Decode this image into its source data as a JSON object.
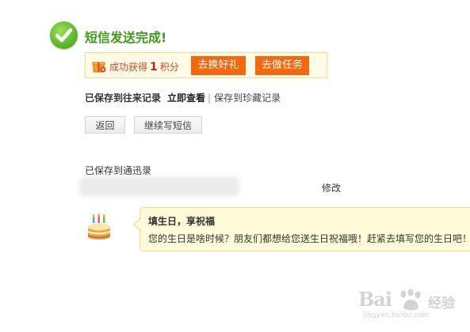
{
  "status": {
    "title": "短信发送完成!"
  },
  "points": {
    "prefix": "成功获得",
    "amount": "1",
    "suffix": "积分",
    "gift_button": "去换好礼",
    "task_button": "去做任务"
  },
  "saved": {
    "label": "已保存到往来记录",
    "view_link": "立即查看",
    "separator": "|",
    "favorite_link": "保存到珍藏记录"
  },
  "actions": {
    "back_button": "返回",
    "continue_button": "继续写短信"
  },
  "contacts": {
    "label": "已保存到通迅录",
    "edit_link": "修改"
  },
  "birthday": {
    "title": "填生日，享祝福",
    "message": "您的生日是啥时候？朋友们都想给您送生日祝福哦！赶紧去填写您的生日吧！"
  },
  "watermark": {
    "brand": "Bai",
    "brand_tail": "经验",
    "url": "jingyan.baidu.com"
  },
  "colors": {
    "success_green": "#3f9a18",
    "accent_orange": "#f5680b",
    "points_red": "#d34a1c",
    "bubble_bg": "#fffbd9"
  }
}
